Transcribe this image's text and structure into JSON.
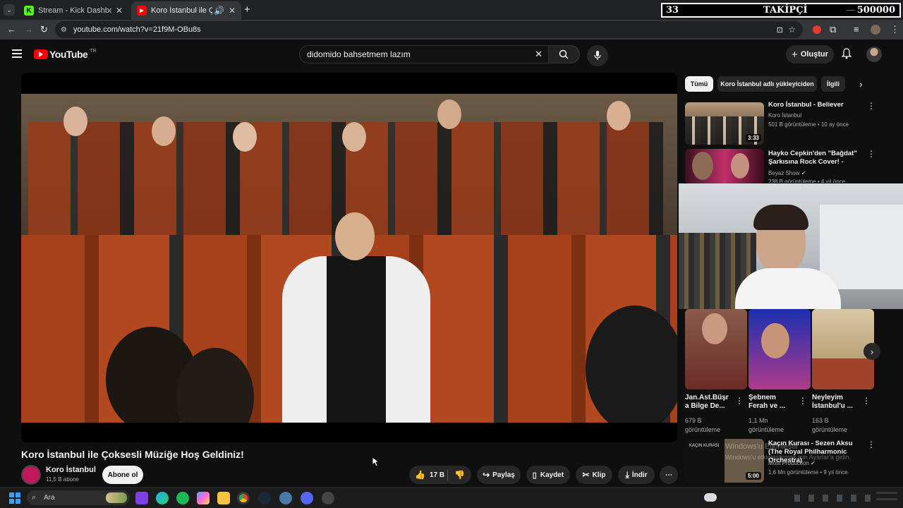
{
  "browser": {
    "tabs": [
      {
        "title": "Stream - Kick Dashboard",
        "favicon": "kick-logo-icon"
      },
      {
        "title": "Koro İstanbul ile Çoksesli M",
        "favicon": "youtube-logo-icon"
      }
    ],
    "new_tab": "+",
    "url": "youtube.com/watch?v=21f9M-OBu8s"
  },
  "overlay": {
    "count": "33",
    "label": "TAKİPÇİ",
    "goal": "500000"
  },
  "youtube": {
    "logo": "YouTube",
    "region": "TR",
    "search_value": "didomido bahsetmem lazım",
    "create_label": "Oluştur"
  },
  "video": {
    "title": "Koro İstanbul ile Çoksesli Müziğe Hoş Geldiniz!",
    "channel": "Koro İstanbul",
    "subscribers": "11,5 B abone",
    "subscribe_label": "Abone ol",
    "likes": "17 B",
    "share_label": "Paylaş",
    "save_label": "Kaydet",
    "clip_label": "Klip",
    "download_label": "İndir"
  },
  "chips": [
    {
      "label": "Tümü",
      "active": true
    },
    {
      "label": "Koro İstanbul adlı yükleyiciden",
      "active": false
    },
    {
      "label": "İlgili",
      "active": false
    }
  ],
  "recommendations": [
    {
      "title": "Koro İstanbul - Believer",
      "channel": "Koro İstanbul",
      "meta": "501 B görüntüleme • 10 ay önce",
      "duration": "3:33"
    },
    {
      "title": "Hayko Cepkin'den \"Bağdat\" Şarkısına Rock Cover! - Beyaz ...",
      "channel": "Beyaz Show",
      "meta": "238 B görüntüleme • 4 yıl önce",
      "duration": ""
    }
  ],
  "shorts": [
    {
      "title": "Jan.Ast.Büşr a Bilge De...",
      "views": "679 B görüntüleme"
    },
    {
      "title": "Şebnem Ferah ve ...",
      "views": "1,1 Mn görüntüleme"
    },
    {
      "title": "Neyleyim İstanbul'u ...",
      "views": "163 B görüntüleme"
    }
  ],
  "bottom_rec": {
    "title": "Kaçın Kurası - Sezen Aksu (The Royal Philharmonic Orchestra)",
    "channel": "Most Production",
    "meta": "1,6 Mn görüntüleme • 9 yıl önce",
    "duration": "5:00",
    "thumb_text": "KAÇIN KURASI"
  },
  "taskbar": {
    "search_placeholder": "Ara"
  },
  "watermark": {
    "line1": "Windows'u Etkinleştir",
    "line2": "Windows'u etkinleştirmek için Ayarlar'a gidin."
  },
  "colors": {
    "youtube_red": "#ff0000",
    "background": "#0f0f0f",
    "chip_bg": "#272727"
  }
}
